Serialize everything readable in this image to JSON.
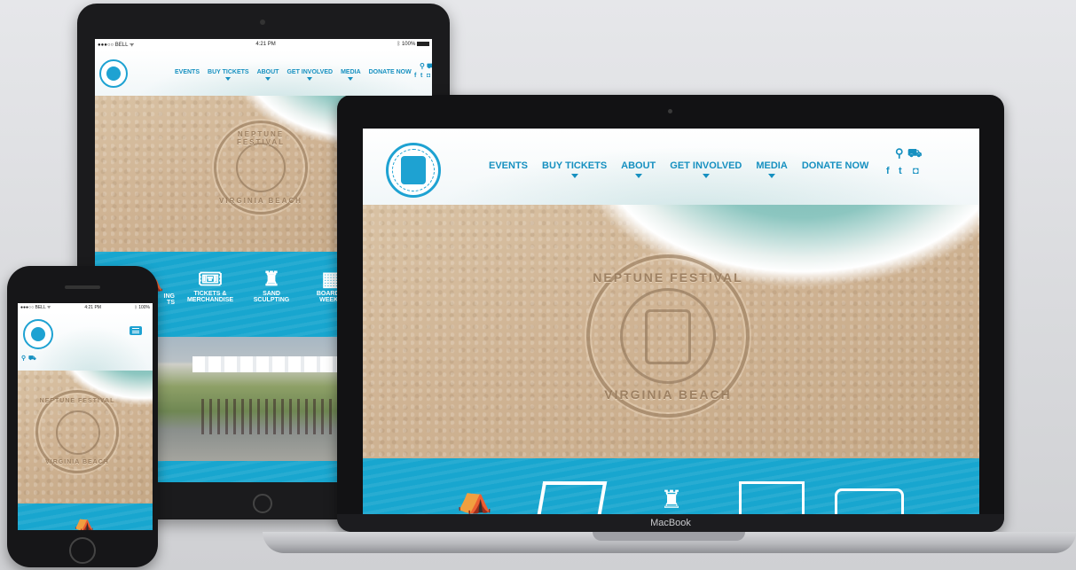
{
  "site": {
    "nav": [
      {
        "label": "EVENTS",
        "dropdown": false
      },
      {
        "label": "BUY TICKETS",
        "dropdown": true
      },
      {
        "label": "ABOUT",
        "dropdown": true
      },
      {
        "label": "GET INVOLVED",
        "dropdown": true
      },
      {
        "label": "MEDIA",
        "dropdown": true
      },
      {
        "label": "DONATE NOW",
        "dropdown": false
      }
    ],
    "stamp_top": "NEPTUNE FESTIVAL",
    "stamp_bottom": "VIRGINIA BEACH",
    "categories": [
      {
        "label_line1": "",
        "label_line2": "",
        "partial_label_1": "ING",
        "partial_label_2": "TS",
        "icon": "tent-icon"
      },
      {
        "label_line1": "TICKETS &",
        "label_line2": "MERCHANDISE",
        "icon": "ticket-icon"
      },
      {
        "label_line1": "SAND",
        "label_line2": "SCULPTING",
        "icon": "sandcastle-icon"
      },
      {
        "label_line1": "BOARDW",
        "label_line2": "WEEKE",
        "icon": "boardwalk-stage-icon"
      }
    ],
    "accent": "#18a6cf",
    "nav_color": "#1690c0"
  },
  "tablet_status": {
    "carrier": "●●●○○ BELL ᯤ",
    "time": "4:21 PM",
    "battery": "ᛒ 100%"
  },
  "phone_status": {
    "carrier": "●●●○○ BELL ᯤ",
    "time": "4:21 PM",
    "battery": "ᛒ 100%"
  },
  "laptop_label": "MacBook",
  "icons": [
    "search-icon",
    "cart-icon",
    "facebook-icon",
    "twitter-icon",
    "instagram-icon",
    "menu-icon",
    "open-book-icon"
  ]
}
